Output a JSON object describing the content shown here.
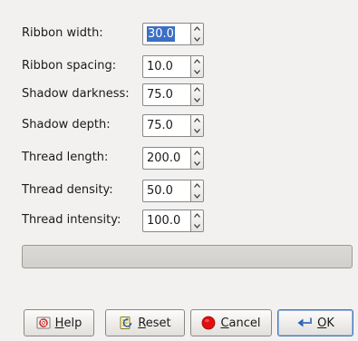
{
  "fields": [
    {
      "label": "Ribbon width:",
      "value": "30.0",
      "selected": true
    },
    {
      "label": "Ribbon spacing:",
      "value": "10.0",
      "selected": false
    },
    {
      "label": "Shadow darkness:",
      "value": "75.0",
      "selected": false
    },
    {
      "label": "Shadow depth:",
      "value": "75.0",
      "selected": false
    },
    {
      "label": "Thread length:",
      "value": "200.0",
      "selected": false
    },
    {
      "label": "Thread density:",
      "value": "50.0",
      "selected": false
    },
    {
      "label": "Thread intensity:",
      "value": "100.0",
      "selected": false
    }
  ],
  "progress": {
    "fraction": 0
  },
  "buttons": {
    "help": {
      "label_hotkey": "H",
      "label_rest": "elp",
      "icon": "help-icon"
    },
    "reset": {
      "label_hotkey": "R",
      "label_rest": "eset",
      "icon": "reset-icon"
    },
    "cancel": {
      "label_hotkey": "C",
      "label_rest": "ancel",
      "icon": "cancel-icon"
    },
    "ok": {
      "label_hotkey": "O",
      "label_rest": "K",
      "icon": "ok-icon"
    }
  },
  "colors": {
    "selection": "#3a6fc4",
    "cancel_icon": "#e01010",
    "default_border": "#4a74b8"
  }
}
